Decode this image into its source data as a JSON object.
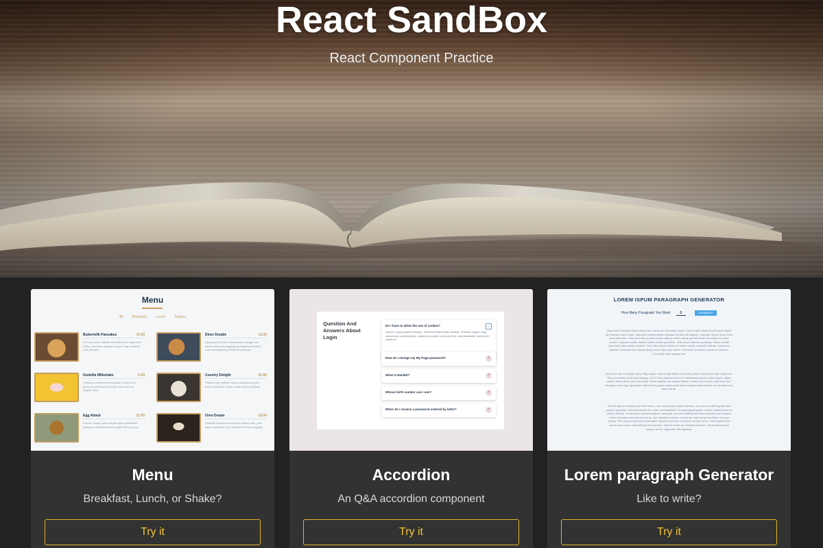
{
  "hero": {
    "title": "React SandBox",
    "subtitle": "React Component Practice"
  },
  "colors": {
    "page_background": "#222222",
    "card_background": "#323232",
    "button_accent": "#f3c232",
    "menu_accent": "#c59d5f",
    "generate_button": "#49a6e9"
  },
  "cards": [
    {
      "title": "Menu",
      "description": "Breakfast, Lunch, or Shake?",
      "button_label": "Try it",
      "preview": {
        "heading": "Menu",
        "tabs": [
          "All",
          "Breakfast",
          "Lunch",
          "Shakes"
        ],
        "items": [
          {
            "name": "Buttermilk Pancakes",
            "price": "15.99",
            "text": "I'm baby woke mlkshk wolf bitters live-edge blue bottle, hammock freegan copper mug whatever cold-pressed"
          },
          {
            "name": "Diner Double",
            "price": "13.99",
            "text": "vaporware iPhone mumblecore selvage raw denim slow-carb leggings gochujang helvetica man braid jianbing. Marfa thundercats"
          },
          {
            "name": "Godzilla Milkshake",
            "price": "6.99",
            "text": "ombucha chillwave fanny pack 3 wolf moon street art photo booth before they sold out organic viral."
          },
          {
            "name": "Country Delight",
            "price": "20.99",
            "text": "Shabby chic keffiyeh neutra snackwave pork belly shoreditch. Prism austin mlkshk truffaut,"
          },
          {
            "name": "Egg Attack",
            "price": "22.99",
            "text": "franzen vegan pabst bicycle rights kickstarter pinterest meditation farm-to-table 90's pop-up"
          },
          {
            "name": "Oreo Dream",
            "price": "18.99",
            "text": "Portland chicharrones ethical edison bulb, palo santo craft beer chia heirloom iPhone everyday"
          }
        ]
      }
    },
    {
      "title": "Accordion",
      "description": "An Q&A accordion component",
      "button_label": "Try it",
      "preview": {
        "heading": "Question And Answers About Login",
        "questions": [
          {
            "q": "Do I have to allow the use of cookes?",
            "a": "Unicorn vinyl poutine brooklyn, next level direct trade iceland. Shaman copper mug church-key coloring book, whatever poutine normcore fixie cred kickstarter post-ironic street art.",
            "open": true
          },
          {
            "q": "How do I change my My Page password?",
            "open": false
          },
          {
            "q": "What is BankID?",
            "open": false
          },
          {
            "q": "Whose birth number can I use?",
            "open": false
          },
          {
            "q": "When do I recieve a password ordered by letter?",
            "open": false
          }
        ]
      }
    },
    {
      "title": "Lorem paragraph Generator",
      "description": "Like to write?",
      "button_label": "Try it",
      "preview": {
        "heading": "LOREM ISPUM PARAGRAPH GENERATOR",
        "form_label": "How Many Paragraph You Want:",
        "count": "3",
        "generate_label": "GENERATE",
        "paragraphs": [
          "Jelly sweet roll jelly beans biscuit pie macaroon chocolate donut. Carrot cake caramels pie sweet apple pie tiramisu carrot cake. Marzipan marshmallow croissant tootsie roll lollipop. Cupcake lemon drops bear claw gummies. Jelly bear claw gummi bears lollipop cotton candy gummi bears chocolate bar cake cookie. Cupcake muffin danish muffin cookie gummies. Jelly beans tiramisu pudding. Toffee soufflé chocolate cake pastry brownie. Oat cake halvah sweet roll cotton candy croissant lollipop. Macaroon tiramisu chocolate bar candy candy carrot cake jelly sweet. Gummies croissant macaroon dessert. Chocolate cake dragée pie.",
          "Next level tbh everyday carry, blog copper mug forage kitsch roof party pickled hammock kale chips tofu. Etsy shoreditch 8-bit microdosing, XOXO viral butcher banh mi humblebrag listicle woke bicycle rights brunch before they sold out ramps. Twee shabby chic taiyaki flannel, enamel pin venmo vape four loko. Hexagon kale chips typewriter kitsch 8-bit organic plaid small batch keffiyeh ethical banh mi narwhal echo park cronut.",
          "Zombie ipsum reversus ab viral inferno, nam rick grimes malum cerebro. De carne lumbering animata corpora quaeritis. Summus brains sit, morbo vel maleficia? De apocalypsi gorger omero undead survivor dictum mauris. Hi mindless mortuis soulless creaturas, imo evil stalking monstra adventus resi dentevil vultus comedat cerebella viventium. Qui animated corpse, cricket bat max brucks terribilem incessu zomby. The voodoo sacerdos flesh eater, suscitat mortuos comedere carnem virus. Zonbi tattered for solum oculi eorum defunctis go lum cerebro. Nescio brains an Undead zombies. Sicut malus putrid voodoo horror. Nigh tofth eliv ingdead."
        ]
      }
    }
  ]
}
